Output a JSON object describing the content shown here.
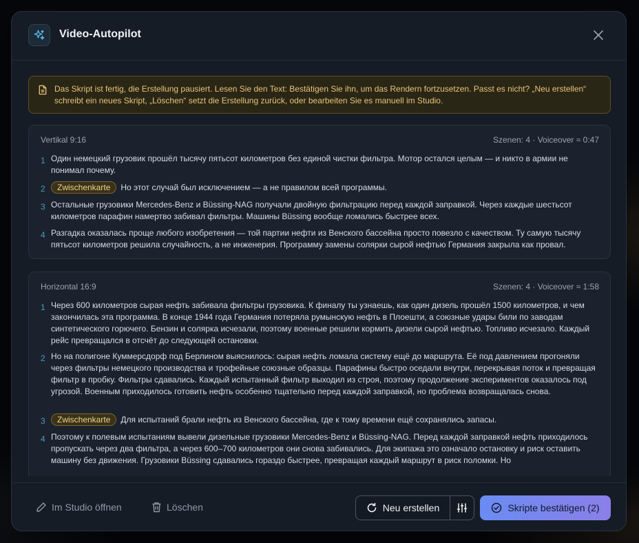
{
  "modal": {
    "title": "Video-Autopilot",
    "icon": "sparkles-icon"
  },
  "notice": {
    "text": "Das Skript ist fertig, die Erstellung pausiert. Lesen Sie den Text: Bestätigen Sie ihn, um das Rendern fortzusetzen. Passt es nicht? „Neu erstellen“ schreibt ein neues Skript, „Löschen“ setzt die Erstellung zurück, oder bearbeiten Sie es manuell im Studio."
  },
  "scripts": [
    {
      "label": "Vertikal 9:16",
      "meta": "Szenen: 4 · Voiceover ≈ 0:47",
      "scenes": [
        {
          "num": "1",
          "chip": "",
          "text": "Один немецкий грузовик прошёл тысячу пятьсот километров без единой чистки фильтра. Мотор остался целым — и никто в армии не понимал почему."
        },
        {
          "num": "2",
          "chip": "Zwischenkarte",
          "text": "Но этот случай был исключением — а не правилом всей программы."
        },
        {
          "num": "3",
          "chip": "",
          "text": "Остальные грузовики Mercedes-Benz и Büssing-NAG получали двойную фильтрацию перед каждой заправкой. Через каждые шестьсот километров парафин намертво забивал фильтры. Машины Büssing вообще ломались быстрее всех."
        },
        {
          "num": "4",
          "chip": "",
          "text": "Разгадка оказалась проще любого изобретения — той партии нефти из Венского бассейна просто повезло с качеством. Ту самую тысячу пятьсот километров решила случайность, а не инженерия. Программу замены солярки сырой нефтью Германия закрыла как провал."
        }
      ]
    },
    {
      "label": "Horizontal 16:9",
      "meta": "Szenen: 4 · Voiceover ≈ 1:58",
      "scenes": [
        {
          "num": "1",
          "chip": "",
          "text": "Через 600 километров сырая нефть забивала фильтры грузовика. К финалу ты узнаешь, как один дизель прошёл 1500 километров, и чем закончилась эта программа. В конце 1944 года Германия потеряла румынскую нефть в Плоешти, а союзные удары били по заводам синтетического горючего. Бензин и солярка исчезали, поэтому военные решили кормить дизели сырой нефтью. Топливо исчезало. Каждый рейс превращался в отсчёт до следующей остановки."
        },
        {
          "num": "2",
          "chip": "",
          "text": "Но на полигоне Куммерсдорф под Берлином выяснилось: сырая нефть ломала систему ещё до маршрута. Её под давлением прогоняли через фильтры немецкого производства и трофейные союзные образцы. Парафины быстро оседали внутри, перекрывая поток и превращая фильтр в пробку. Фильтры сдавались. Каждый испытанный фильтр выходил из строя, поэтому продолжение экспериментов оказалось под угрозой. Военным приходилось готовить нефть особенно тщательно перед каждой заправкой, но проблема возвращалась снова."
        },
        {
          "num": "3",
          "chip": "Zwischenkarte",
          "text": "Для испытаний брали нефть из Венского бассейна, где к тому времени ещё сохранялись запасы."
        },
        {
          "num": "4",
          "chip": "",
          "text": "Поэтому к полевым испытаниям вывели дизельные грузовики Mercedes-Benz и Büssing-NAG. Перед каждой заправкой нефть приходилось пропускать через два фильтра, а через 600–700 километров они снова забивались. Для экипажа это означало остановку и риск оставить машину без движения. Грузовики Büssing сдавались гораздо быстрее, превращая каждый маршрут в риск поломки. Но"
        }
      ]
    }
  ],
  "footer": {
    "studio_label": "Im Studio öffnen",
    "delete_label": "Löschen",
    "regenerate_label": "Neu erstellen",
    "confirm_label": "Skripte bestätigen (2)"
  },
  "colors": {
    "accent_start": "#6a8cf2",
    "accent_end": "#8b7fe8",
    "notice_text": "#e8c477",
    "scene_number": "#4a9ac5"
  }
}
